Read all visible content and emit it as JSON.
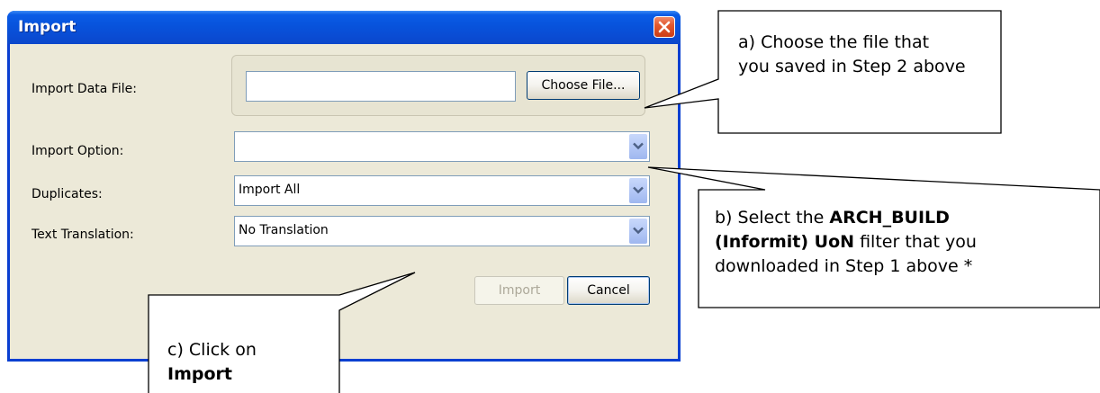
{
  "dialog": {
    "title": "Import",
    "close_icon": "close-icon",
    "labels": {
      "import_data_file": "Import Data File:",
      "import_option": "Import Option:",
      "duplicates": "Duplicates:",
      "text_translation": "Text Translation:"
    },
    "file_input_value": "",
    "choose_file_label": "Choose File...",
    "import_option_value": "",
    "duplicates_value": "Import All",
    "text_translation_value": "No Translation",
    "import_label": "Import",
    "cancel_label": "Cancel"
  },
  "callouts": {
    "a": {
      "line1": "a) Choose the file that",
      "line2": "you saved in Step 2 above"
    },
    "b": {
      "line1_prefix": "b) Select the ",
      "line1_bold": "ARCH_BUILD",
      "line2_bold": "(Informit) UoN",
      "line2_suffix": " filter that you",
      "line3": "downloaded in Step 1 above *"
    },
    "c": {
      "line1": "c) Click on",
      "line2_bold": "Import"
    }
  },
  "colors": {
    "title_bar": "#0a5ce6",
    "client_bg": "#ece9d8",
    "close_button": "#e2592f",
    "combo_arrow": "#b4c8f6"
  }
}
